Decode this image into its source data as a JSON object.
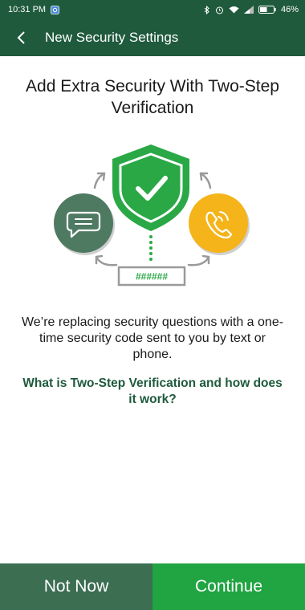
{
  "status_bar": {
    "time": "10:31 PM",
    "battery": "46%",
    "icons": [
      "notification-app-icon",
      "bluetooth-icon",
      "alarm-icon",
      "wifi-icon",
      "signal-icon",
      "battery-icon"
    ]
  },
  "app_bar": {
    "title": "New Security Settings",
    "back_icon": "back-arrow-icon"
  },
  "main": {
    "headline": "Add Extra Security With Two-Step Verification",
    "illustration": {
      "code_text": "######",
      "icons": [
        "shield-check-icon",
        "chat-bubble-icon",
        "phone-icon"
      ]
    },
    "description": "We’re replacing security questions with a one-time security code sent to you by text or phone.",
    "help_link": "What is Two-Step Verification and how does it work?"
  },
  "footer": {
    "not_now_label": "Not Now",
    "continue_label": "Continue"
  },
  "colors": {
    "header": "#1f5a3c",
    "shield": "#2aa846",
    "chat_circle": "#4f7a62",
    "phone_circle": "#f4b41a",
    "not_now_bg": "#3c6e52",
    "continue_bg": "#21a442",
    "link": "#1f5a3c"
  }
}
